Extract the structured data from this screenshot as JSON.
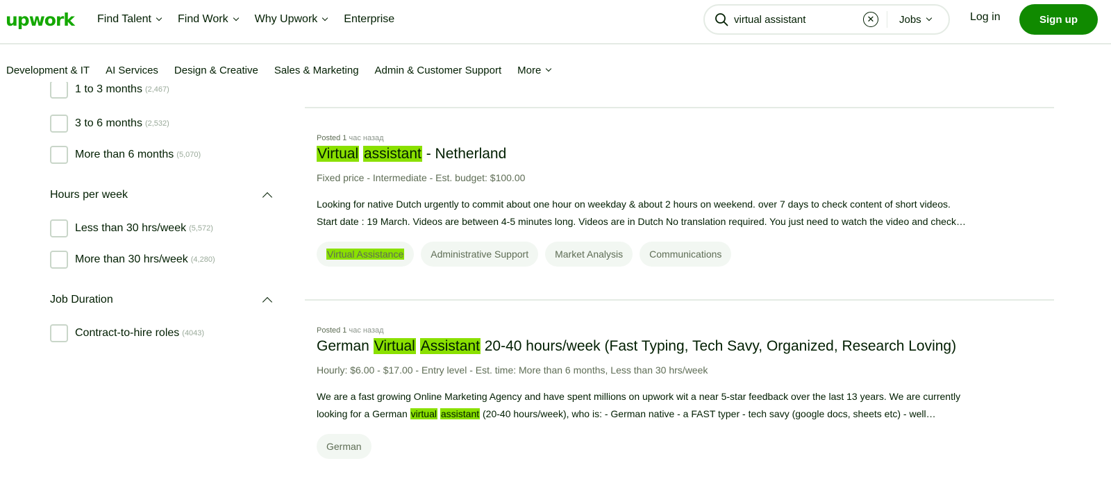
{
  "header": {
    "logo": "upwork",
    "nav": [
      {
        "label": "Find Talent",
        "has_dropdown": true
      },
      {
        "label": "Find Work",
        "has_dropdown": true
      },
      {
        "label": "Why Upwork",
        "has_dropdown": true
      },
      {
        "label": "Enterprise",
        "has_dropdown": false
      }
    ],
    "search": {
      "value": "virtual assistant",
      "scope": "Jobs",
      "search_icon": "search-icon",
      "clear_icon": "clear-icon"
    },
    "login_label": "Log in",
    "signup_label": "Sign up"
  },
  "categories": [
    {
      "label": "Development & IT"
    },
    {
      "label": "AI Services"
    },
    {
      "label": "Design & Creative"
    },
    {
      "label": "Sales & Marketing"
    },
    {
      "label": "Admin & Customer Support"
    },
    {
      "label": "More",
      "has_dropdown": true
    }
  ],
  "filters": {
    "project_length_options": [
      {
        "label": "1 to 3 months",
        "count": "(2,467)"
      },
      {
        "label": "3 to 6 months",
        "count": "(2,532)"
      },
      {
        "label": "More than 6 months",
        "count": "(5,070)"
      }
    ],
    "hours_per_week": {
      "heading": "Hours per week",
      "options": [
        {
          "label": "Less than 30 hrs/week",
          "count": "(5,572)"
        },
        {
          "label": "More than 30 hrs/week",
          "count": "(4,280)"
        }
      ]
    },
    "job_duration": {
      "heading": "Job Duration",
      "options": [
        {
          "label": "Contract-to-hire roles",
          "count": "(4043)"
        }
      ]
    }
  },
  "jobs": [
    {
      "posted_prefix": "Posted 1",
      "posted_suffix": "час назад",
      "title_hl1": "Virtual",
      "title_hl2": "assistant",
      "title_rest": " - Netherland",
      "meta": "Fixed price - Intermediate - Est. budget: $100.00",
      "desc_line1": "Looking for native Dutch urgently to commit about one hour on weekday & about 2 hours on weekend. over 7 days to check content of short videos.",
      "desc_line2": "Start date : 19 March. Videos are between 4-5 minutes long. Videos are in Dutch No translation required. You just need to watch the video and check…",
      "tags": [
        "Virtual Assistance",
        "Administrative Support",
        "Market Analysis",
        "Communications"
      ]
    },
    {
      "posted_prefix": "Posted 1",
      "posted_suffix": "час назад",
      "title_pre": "German ",
      "title_hl1": "Virtual",
      "title_hl2": "Assistant",
      "title_rest": " 20-40 hours/week (Fast Typing, Tech Savy, Organized, Research Loving)",
      "meta": "Hourly: $6.00 - $17.00 - Entry level - Est. time: More than 6 months, Less than 30 hrs/week",
      "desc_line1": "We are a fast growing Online Marketing Agency and have spent millions on upwork wit a near 5-star feedback over the last 13 years. We are currently",
      "desc_line2_pre": "looking for a German ",
      "desc_line2_hl1": "virtual",
      "desc_line2_hl2": "assistant",
      "desc_line2_rest": " (20-40 hours/week), who is: - German native - a FAST typer - tech savy (google docs, sheets etc) - well…",
      "tags": [
        "German"
      ]
    }
  ],
  "colors": {
    "brand_green": "#14a800",
    "signup_green": "#108a00",
    "highlight": "#8ae000",
    "meta_text": "#5e6d55"
  }
}
